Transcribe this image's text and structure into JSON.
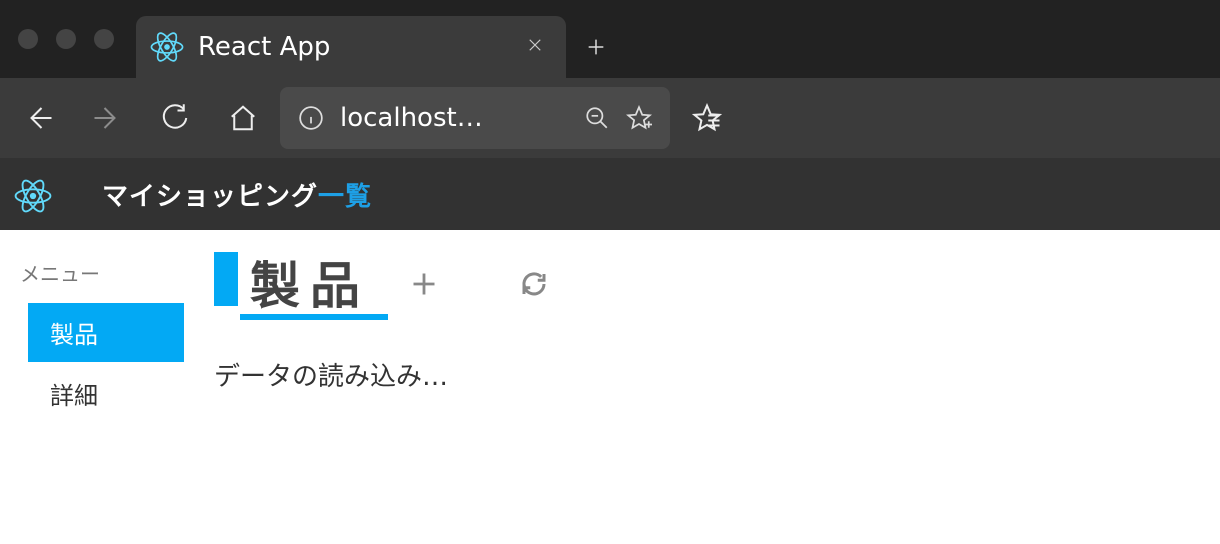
{
  "browser": {
    "tab_title": "React App",
    "address": "localhost…",
    "icons": {
      "close": "close-icon",
      "new_tab": "plus-icon",
      "back": "back-icon",
      "forward": "forward-icon",
      "reload": "reload-icon",
      "home": "home-icon",
      "info": "info-icon",
      "zoom_out": "zoom-out-icon",
      "favorite": "star-add-icon",
      "collections": "collections-icon"
    }
  },
  "app": {
    "title_prefix": "マイショッピング",
    "title_highlight": "一覧",
    "logo_name": "react-logo-icon"
  },
  "sidebar": {
    "label": "メニュー",
    "items": [
      {
        "label": "製品",
        "active": true
      },
      {
        "label": "詳細",
        "active": false
      }
    ]
  },
  "content": {
    "heading": "製品",
    "add_icon": "plus-icon",
    "refresh_icon": "refresh-icon",
    "loading_text": "データの読み込み…"
  }
}
